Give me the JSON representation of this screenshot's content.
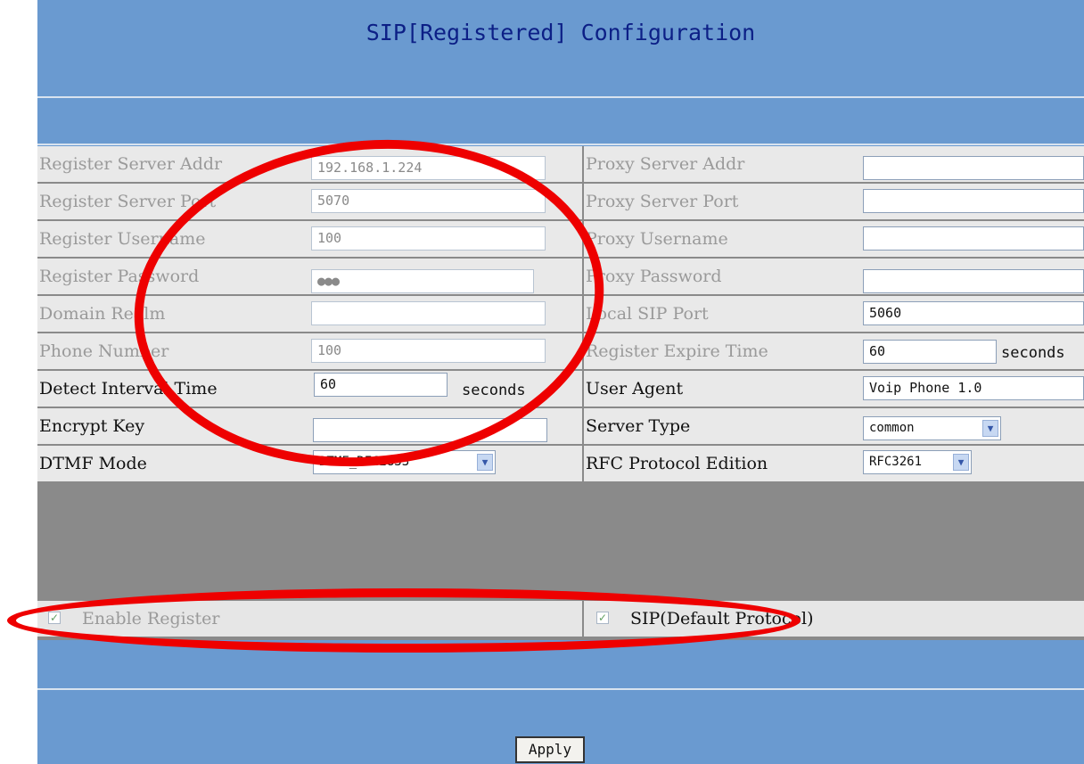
{
  "title": "SIP[Registered] Configuration",
  "left_rows": [
    {
      "label": "Register Server Addr",
      "value": "192.168.1.224",
      "disabled": true
    },
    {
      "label": "Register Server Port",
      "value": "5070",
      "disabled": true
    },
    {
      "label": "Register Username",
      "value": "100",
      "disabled": true
    },
    {
      "label": "Register Password",
      "value": "●●●",
      "disabled": true
    },
    {
      "label": "Domain Realm",
      "value": "",
      "disabled": true
    },
    {
      "label": "Phone Number",
      "value": "100",
      "disabled": true
    },
    {
      "label": "Detect Interval Time",
      "value": "60",
      "unit": "seconds"
    },
    {
      "label": "Encrypt Key",
      "value": ""
    },
    {
      "label": "DTMF Mode",
      "select": "DTMF_RFC2833"
    }
  ],
  "right_rows": [
    {
      "label": "Proxy Server Addr",
      "value": ""
    },
    {
      "label": "Proxy Server Port",
      "value": ""
    },
    {
      "label": "Proxy Username",
      "value": ""
    },
    {
      "label": "Proxy Password",
      "value": ""
    },
    {
      "label": "Local SIP Port",
      "value": "5060"
    },
    {
      "label": "Register Expire Time",
      "value": "60",
      "unit": "seconds"
    },
    {
      "label": "User Agent",
      "value": "Voip Phone 1.0"
    },
    {
      "label": "Server Type",
      "select": "common"
    },
    {
      "label": "RFC Protocol Edition",
      "select": "RFC3261"
    }
  ],
  "checkboxes": {
    "enable_register": {
      "label": "Enable Register",
      "checked": true
    },
    "sip_default": {
      "label": "SIP(Default Protocol)",
      "checked": true
    }
  },
  "apply_label": "Apply",
  "colors": {
    "header_bg": "#6a9ad0",
    "title": "#0c1f86",
    "annotation": "#ee0000"
  }
}
